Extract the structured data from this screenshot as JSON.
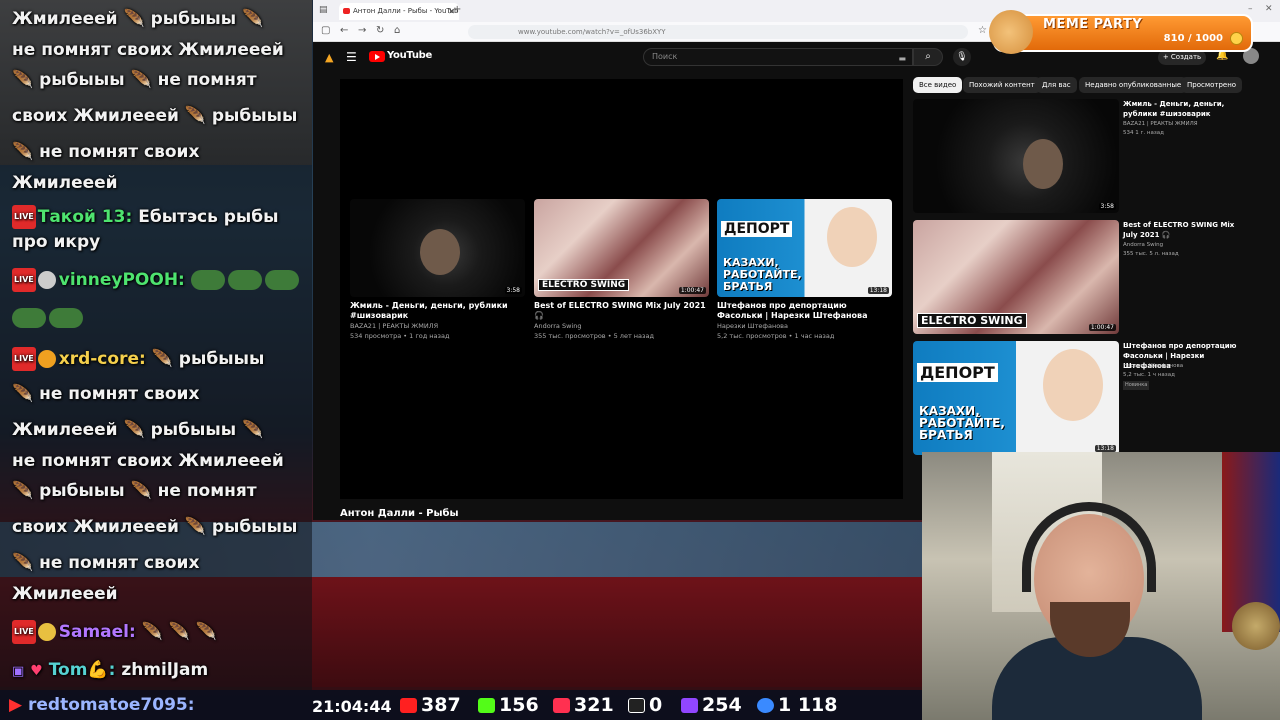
{
  "chat": {
    "lines": [
      "Жмилееей 🪶 рыбыыы 🪶",
      "не помнят своих Жмилееей",
      "🪶 рыбыыы 🪶 не помнят",
      "своих Жмилееей 🪶 рыбыыы",
      "🪶 не помнят своих",
      "Жмилееей"
    ],
    "msg1_name": "Такой 13:",
    "msg1_text": "Ебытэсь рыбы",
    "msg1_text2": "про икру",
    "msg2_name": "vinneyPOOH:",
    "msg3_name": "xrd-core:",
    "msg3_lines": [
      "🪶 рыбыыы",
      "🪶 не помнят своих",
      "Жмилееей 🪶 рыбыыы 🪶",
      "не помнят своих Жмилееей",
      "🪶 рыбыыы 🪶 не помнят",
      "своих Жмилееей 🪶 рыбыыы",
      "🪶 не помнят своих",
      "Жмилееей"
    ],
    "msg4_name": "Samael:",
    "msg4_text": "🪶 🪶 🪶",
    "msg5_name": "Tom💪:",
    "msg5_text": "zhmilJam",
    "live_badge": "LIVE"
  },
  "browser": {
    "tab_title": "Антон Далли - Рыбы - YouTube",
    "url": "www.youtube.com/watch?v=_ofUs36bXYY"
  },
  "youtube": {
    "logo_text": "YouTube",
    "search_placeholder": "Поиск",
    "create_label": "+ Создать",
    "video_title": "Антон Далли - Рыбы",
    "endcards": [
      {
        "title": "Жмиль - Деньги, деньги, рублики #шизоварик",
        "channel": "BAZA21 | РЕАКТЫ ЖМИЛЯ",
        "meta": "534 просмотра • 1 год назад",
        "duration": "3:58"
      },
      {
        "title": "Best of ELECTRO SWING Mix July 2021 🎧",
        "channel": "Andorra Swing",
        "meta": "355 тыс. просмотров • 5 лет назад",
        "duration": "1:00:47"
      },
      {
        "title": "Штефанов про депортацию Фасольки | Нарезки Штефанова",
        "channel": "Нарезки Штефанова",
        "meta": "5,2 тыс. просмотров • 1 час назад",
        "duration": "13:18"
      }
    ],
    "chips": [
      "Все видео",
      "Похожий контент",
      "Для вас",
      "Недавно опубликованные",
      "Просмотрено"
    ],
    "sidebar": [
      {
        "title": "Жмиль - Деньги, деньги, рублики #шизоварик",
        "channel": "BAZA21 | РЕАКТЫ ЖМИЛЯ",
        "meta": "534  1 г. назад",
        "duration": "3:58"
      },
      {
        "title": "Best of ELECTRO SWING Mix July 2021 🎧",
        "channel": "Andorra Swing",
        "meta": "355 тыс.  5 л. назад",
        "duration": "1:00:47"
      },
      {
        "title": "Штефанов про депортацию Фасольки | Нарезки Штефанова",
        "channel": "Нарезки Штефанова",
        "meta": "5,2 тыс.  1 ч назад",
        "badge": "Новинка",
        "duration": "13:18"
      }
    ],
    "thumb_text": {
      "electro": "ELECTRO SWING",
      "depo": "ДЕПОРТ",
      "depo_sub": "КАЗАХИ, РАБОТАЙТЕ, БРАТЬЯ"
    }
  },
  "overlay": {
    "meme_title": "MEME PARTY",
    "meme_score": "810 / 1000"
  },
  "stats": {
    "user": "redtomatoe7095:",
    "time": "21:04:44",
    "youtube": "387",
    "kick": "156",
    "live": "321",
    "r": "0",
    "twitch": "254",
    "viewers": "1 118"
  }
}
